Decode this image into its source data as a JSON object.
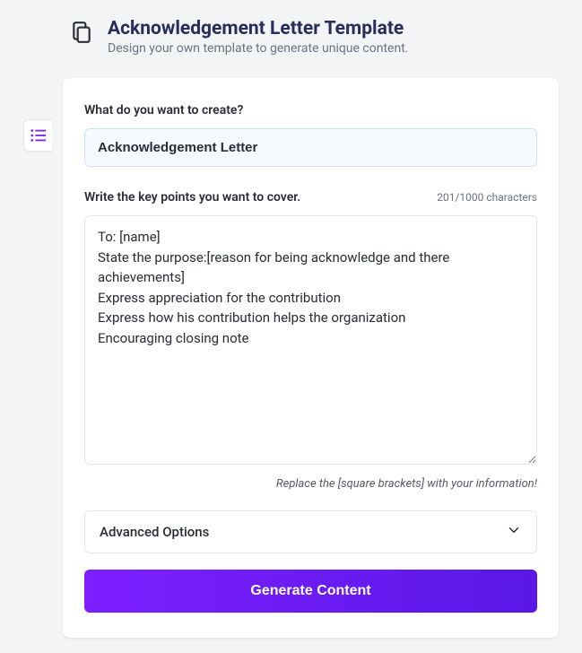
{
  "header": {
    "title": "Acknowledgement Letter Template",
    "subtitle": "Design your own template to generate unique content."
  },
  "form": {
    "create_label": "What do you want to create?",
    "create_value": "Acknowledgement Letter",
    "keypoints_label": "Write the key points you want to cover.",
    "keypoints_counter": "201/1000 characters",
    "keypoints_value": "To: [name]\nState the purpose:[reason for being acknowledge and there achievements]\nExpress appreciation for the contribution\nExpress how his contribution helps the organization\nEncouraging closing note",
    "hint": "Replace the [square brackets] with your information!"
  },
  "advanced": {
    "label": "Advanced Options"
  },
  "actions": {
    "generate_label": "Generate Content"
  }
}
